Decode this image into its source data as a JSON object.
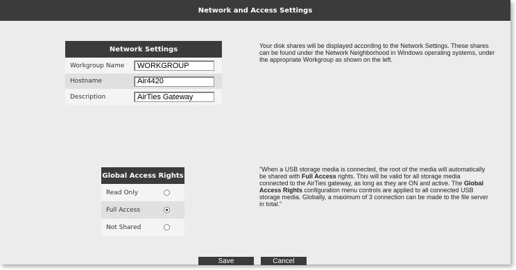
{
  "header": {
    "title": "Network and Access Settings"
  },
  "network_settings": {
    "title": "Network Settings",
    "fields": [
      {
        "label": "Workgroup Name",
        "value": "WORKGROUP"
      },
      {
        "label": "Hostname",
        "value": "Air4420"
      },
      {
        "label": "Description",
        "value": "AirTies Gateway"
      }
    ],
    "info": "Your disk shares will be displayed according to the Network Settings. These shares can be found under the Network Neighborhood in Windows operating systems, under the appropriate Workgroup as shown on the left."
  },
  "global_access_rights": {
    "title": "Global Access Rights",
    "options": [
      {
        "label": "Read Only",
        "checked": false
      },
      {
        "label": "Full Access",
        "checked": true
      },
      {
        "label": "Not Shared",
        "checked": false
      }
    ],
    "info": {
      "part1": "\"When a USB storage media is connected, the root of the media will automatically be shared with ",
      "bold1": "Full Access",
      "part2": " rights. This will be valid for all storage media connected to the AirTies gateway, as long as they are ON and active. The ",
      "bold2": "Global Access Rights",
      "part3": " configuration menu controls are applied to all connected USB storage media. Globally, a maximum of 3 connection can be made to the file server in total.\""
    }
  },
  "actions": {
    "save_label": "Save",
    "cancel_label": "Cancel"
  }
}
